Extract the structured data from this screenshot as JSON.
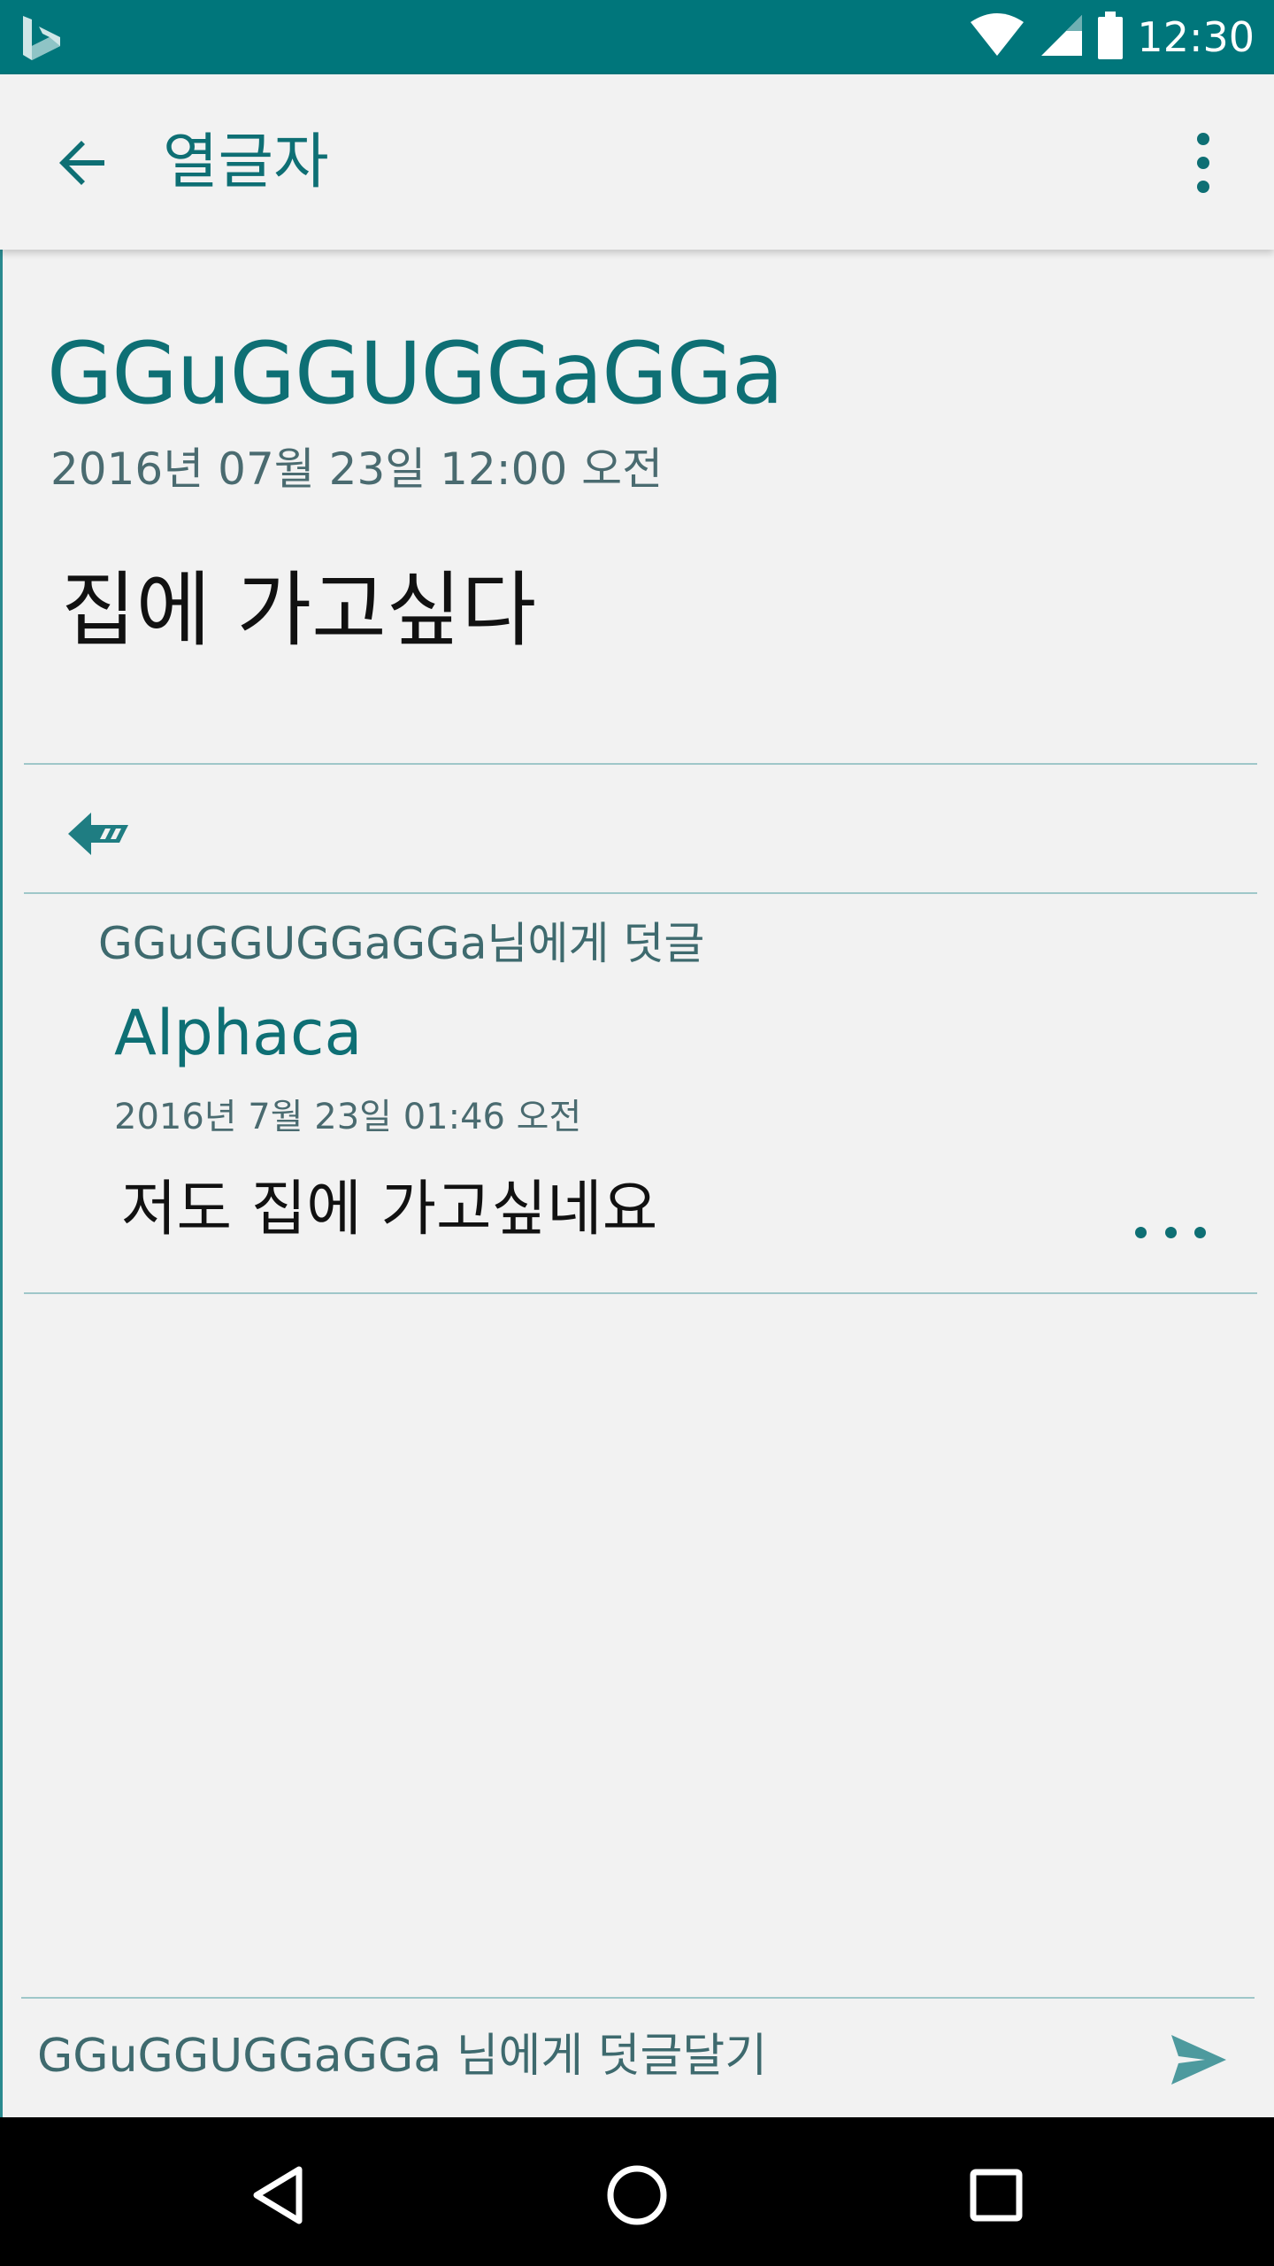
{
  "status_bar": {
    "time": "12:30",
    "logo_icon": "bing-logo-icon",
    "wifi_icon": "wifi-icon",
    "signal_icon": "cell-signal-icon",
    "battery_icon": "battery-icon"
  },
  "app_bar": {
    "title": "열글자",
    "back_icon": "arrow-back-icon",
    "menu_icon": "more-vert-icon"
  },
  "post": {
    "author": "GGuGGUGGaGGa",
    "date": "2016년 07월 23일 12:00 오전",
    "body": "집에 가고싶다"
  },
  "reply_action": {
    "icon": "reply-arrow-icon"
  },
  "comment": {
    "reply_to": "GGuGGUGGaGGa님에게 덧글",
    "author": "Alphaca",
    "date": "2016년 7월 23일 01:46 오전",
    "body": "저도 집에 가고싶네요",
    "more_icon": "more-horiz-icon"
  },
  "comment_input": {
    "placeholder": "GGuGGUGGaGGa 님에게 덧글달기",
    "send_icon": "send-icon"
  },
  "nav_bar": {
    "back_icon": "nav-back-icon",
    "home_icon": "nav-home-icon",
    "recents_icon": "nav-recents-icon"
  },
  "colors": {
    "accent": "#00767b",
    "text_primary": "#111111",
    "divider": "#9fc7c9",
    "background": "#f2f2f2"
  }
}
